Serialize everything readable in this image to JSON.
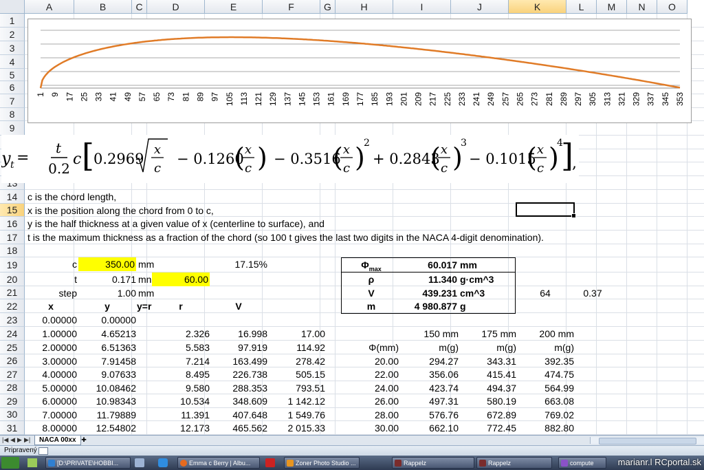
{
  "columns": [
    "A",
    "B",
    "C",
    "D",
    "E",
    "F",
    "G",
    "H",
    "I",
    "J",
    "K",
    "L",
    "M",
    "N",
    "O"
  ],
  "selected_column": "K",
  "rows": [
    "1",
    "2",
    "3",
    "4",
    "5",
    "6",
    "7",
    "8",
    "9",
    "10",
    "11",
    "12",
    "13",
    "14",
    "15",
    "16",
    "17",
    "18",
    "19",
    "20",
    "21",
    "22",
    "23",
    "24",
    "25",
    "26",
    "27",
    "28",
    "29",
    "30",
    "31"
  ],
  "selected_row": "15",
  "chart": {
    "x_labels": [
      "1",
      "9",
      "17",
      "25",
      "33",
      "41",
      "49",
      "57",
      "65",
      "73",
      "81",
      "89",
      "97",
      "105",
      "113",
      "121",
      "129",
      "137",
      "145",
      "153",
      "161",
      "169",
      "177",
      "185",
      "193",
      "201",
      "209",
      "217",
      "225",
      "233",
      "241",
      "249",
      "257",
      "265",
      "273",
      "281",
      "289",
      "297",
      "305",
      "313",
      "321",
      "329",
      "337",
      "345",
      "353"
    ],
    "line_color": "#e07b27",
    "chart_data": {
      "type": "line",
      "x_start": 1,
      "x_end": 353,
      "x_step": 8,
      "series": [
        {
          "values_desc": "half-thickness profile y(x) for x = 0..352 mm"
        }
      ]
    }
  },
  "formula": {
    "lhs": "y",
    "sub": "t",
    "frac_num": "t",
    "frac_den": "0.2",
    "c": "c",
    "t1": "0.2969",
    "t2": "− 0.1260",
    "t3": "− 0.3516",
    "t4": "+ 0.2843",
    "t5": "− 0.1015",
    "exp2": "2",
    "exp3": "3",
    "exp4": "4",
    "x": "x",
    "tail": ","
  },
  "notes": [
    "c is the chord length,",
    "x is the position along the chord from 0 to c,",
    "y is the half thickness at a given value of x (centerline to surface), and",
    "t is the maximum thickness as a fraction of the chord (so 100 t gives the last two digits in the NACA 4-digit denomination)."
  ],
  "params": {
    "c_label": "c",
    "c_value": "350.00",
    "c_unit": "mm",
    "t_label": "t",
    "t_value": "0.171",
    "t_unit": "mn",
    "step_label": "step",
    "step_value": "1.00",
    "step_unit": "mm",
    "pct": "17.15%",
    "d20": "60.00",
    "k21": "64",
    "l21": "0.37"
  },
  "result_box": {
    "phi_label": "Φ",
    "phi_sub": "max",
    "phi_value": "60.017",
    "phi_unit": "mm",
    "rho_label": "ρ",
    "rho_value": "11.340",
    "rho_unit": "g·cm^3",
    "v_label": "V",
    "v_value": "439.231",
    "v_unit": "cm^3",
    "m_label": "m",
    "m_value": "4 980.877",
    "m_unit": "g"
  },
  "table_headers": {
    "x": "x",
    "y": "y",
    "c": "y=r",
    "r": "r",
    "v": "V"
  },
  "table_rows": [
    {
      "x": "0.00000",
      "y": "0.00000",
      "r": "",
      "v": "",
      "f": ""
    },
    {
      "x": "1.00000",
      "y": "4.65213",
      "r": "2.326",
      "v": "16.998",
      "f": "17.00"
    },
    {
      "x": "2.00000",
      "y": "6.51363",
      "r": "5.583",
      "v": "97.919",
      "f": "114.92"
    },
    {
      "x": "3.00000",
      "y": "7.91458",
      "r": "7.214",
      "v": "163.499",
      "f": "278.42"
    },
    {
      "x": "4.00000",
      "y": "9.07633",
      "r": "8.495",
      "v": "226.738",
      "f": "505.15"
    },
    {
      "x": "5.00000",
      "y": "10.08462",
      "r": "9.580",
      "v": "288.353",
      "f": "793.51"
    },
    {
      "x": "6.00000",
      "y": "10.98343",
      "r": "10.534",
      "v": "348.609",
      "f": "1 142.12"
    },
    {
      "x": "7.00000",
      "y": "11.79889",
      "r": "11.391",
      "v": "407.648",
      "f": "1 549.76"
    },
    {
      "x": "8.00000",
      "y": "12.54802",
      "r": "12.173",
      "v": "465.562",
      "f": "2 015.33"
    }
  ],
  "mass_table": {
    "headers": [
      "150 mm",
      "175 mm",
      "200 mm"
    ],
    "phi_header": "Φ(mm)",
    "unit": "m(g)",
    "rows": [
      [
        "20.00",
        "294.27",
        "343.31",
        "392.35"
      ],
      [
        "22.00",
        "356.06",
        "415.41",
        "474.75"
      ],
      [
        "24.00",
        "423.74",
        "494.37",
        "564.99"
      ],
      [
        "26.00",
        "497.31",
        "580.19",
        "663.08"
      ],
      [
        "28.00",
        "576.76",
        "672.89",
        "769.02"
      ],
      [
        "30.00",
        "662.10",
        "772.45",
        "882.80"
      ]
    ]
  },
  "sheet_tab": "NACA 00xx",
  "status": "Pripravený",
  "taskbar": [
    "[D:\\PRIVATE\\HOBBI...",
    "Emma c Berry | Albu...",
    "Zoner Photo Studio ...",
    "Rappelz",
    "Rappelz",
    "compute"
  ],
  "watermark": "marianr.l RCportal.sk"
}
